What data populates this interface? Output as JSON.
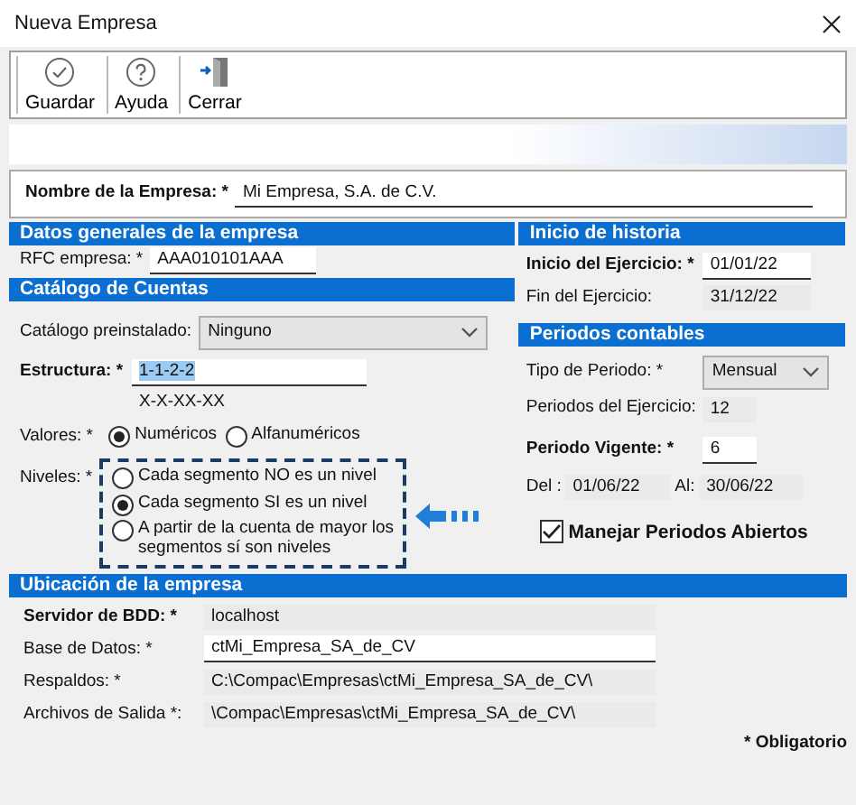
{
  "window": {
    "title": "Nueva Empresa"
  },
  "toolbar": {
    "buttons": [
      {
        "label": "Guardar"
      },
      {
        "label": "Ayuda"
      },
      {
        "label": "Cerrar"
      }
    ]
  },
  "company": {
    "label": "Nombre de la Empresa: *",
    "bold": true,
    "kind": "input",
    "value": "Mi Empresa, S.A. de C.V."
  },
  "general": {
    "title": "Datos generales de la empresa",
    "fields": [
      {
        "label": "RFC empresa: *",
        "bold": false,
        "kind": "input",
        "value": "AAA010101AAA"
      }
    ]
  },
  "catalog": {
    "title": "Catálogo de Cuentas",
    "preinstalled": {
      "label": "Catálogo preinstalado:",
      "bold": false,
      "kind": "select",
      "value": "Ninguno"
    },
    "structure": {
      "label": "Estructura: *",
      "bold": true,
      "kind": "input",
      "value": "1-1-2-2",
      "text_selected": true
    },
    "mask": "X-X-XX-XX",
    "values": {
      "label": "Valores: *",
      "options": [
        {
          "label": "Numéricos",
          "selected": true
        },
        {
          "label": "Alfanuméricos",
          "selected": false
        }
      ]
    },
    "levels": {
      "label": "Niveles: *",
      "highlighted": true,
      "options": [
        {
          "label": "Cada segmento NO es un nivel",
          "selected": false
        },
        {
          "label": "Cada segmento SI es un nivel",
          "selected": true
        },
        {
          "label": "A partir de la cuenta de mayor los segmentos sí son niveles",
          "selected": false
        }
      ]
    }
  },
  "history": {
    "title": "Inicio de historia",
    "fields": [
      {
        "label": "Inicio del Ejercicio: *",
        "bold": true,
        "kind": "input",
        "value": "01/01/22"
      },
      {
        "label": "Fin del Ejercicio:",
        "bold": false,
        "kind": "readonly",
        "value": "31/12/22"
      }
    ]
  },
  "periods": {
    "title": "Periodos contables",
    "fields": [
      {
        "label": "Tipo de Periodo: *",
        "bold": false,
        "kind": "select",
        "value": "Mensual"
      },
      {
        "label": "Periodos del Ejercicio:",
        "bold": false,
        "kind": "readonly",
        "value": "12"
      },
      {
        "label": "Periodo Vigente: *",
        "bold": true,
        "kind": "input",
        "value": "6"
      }
    ],
    "range": [
      {
        "label": "Del :",
        "value": "01/06/22"
      },
      {
        "label": "Al:",
        "value": "30/06/22"
      }
    ],
    "open_periods": {
      "label": "Manejar Periodos Abiertos",
      "checked": true
    }
  },
  "location": {
    "title": "Ubicación de la empresa",
    "fields": [
      {
        "label": "Servidor de BDD: *",
        "bold": true,
        "kind": "readonly",
        "value": "localhost"
      },
      {
        "label": "Base de Datos: *",
        "bold": false,
        "kind": "input",
        "value": "ctMi_Empresa_SA_de_CV"
      },
      {
        "label": "Respaldos: *",
        "bold": false,
        "kind": "readonly",
        "value": "C:\\Compac\\Empresas\\ctMi_Empresa_SA_de_CV\\"
      },
      {
        "label": "Archivos de Salida *:",
        "bold": false,
        "kind": "readonly",
        "value": "\\Compac\\Empresas\\ctMi_Empresa_SA_de_CV\\"
      }
    ]
  },
  "footer": {
    "note": "* Obligatorio"
  }
}
